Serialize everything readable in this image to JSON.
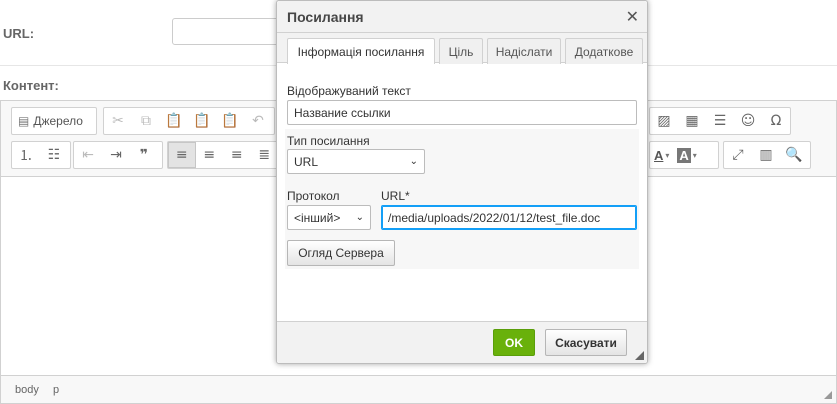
{
  "form": {
    "url_label": "URL:",
    "content_label": "Контент:"
  },
  "editor": {
    "source_label": "Джерело",
    "path": [
      "body",
      "p"
    ],
    "icons": [
      "source-icon",
      "cut-icon",
      "copy-icon",
      "paste-icon",
      "paste-text-icon",
      "paste-word-icon",
      "undo-icon",
      "image-icon",
      "table-icon",
      "horizontal-rule-icon",
      "smiley-icon",
      "special-char-icon",
      "numbered-list-icon",
      "bulleted-list-icon",
      "outdent-icon",
      "indent-icon",
      "blockquote-icon",
      "align-left-icon",
      "align-center-icon",
      "align-right-icon",
      "justify-icon",
      "text-color-icon",
      "background-color-icon",
      "maximize-icon",
      "show-blocks-icon",
      "preview-icon"
    ]
  },
  "dialog": {
    "title": "Посилання",
    "tabs": [
      {
        "label": "Інформація посилання",
        "active": true
      },
      {
        "label": "Ціль",
        "active": false
      },
      {
        "label": "Надіслати",
        "active": false
      },
      {
        "label": "Додаткове",
        "active": false
      }
    ],
    "display_text_label": "Відображуваний текст",
    "display_text_value": "Название ссылки",
    "link_type_label": "Тип посилання",
    "link_type_value": "URL",
    "protocol_label": "Протокол",
    "protocol_value": "<інший>",
    "url_label": "URL*",
    "url_value": "/media/uploads/2022/01/12/test_file.doc",
    "browse_server_label": "Огляд Сервера",
    "ok_label": "OK",
    "cancel_label": "Скасувати"
  },
  "colors": {
    "ok_button": "#69b10b",
    "focus_border": "#139ff7",
    "toolbar_bg": "#f8f8f8"
  }
}
